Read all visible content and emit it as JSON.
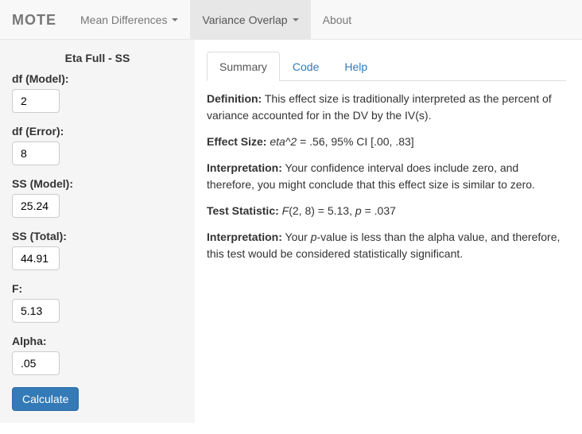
{
  "navbar": {
    "brand": "MOTE",
    "items": [
      {
        "label": "Mean Differences"
      },
      {
        "label": "Variance Overlap"
      },
      {
        "label": "About"
      }
    ]
  },
  "sidebar": {
    "title": "Eta Full - SS",
    "fields": {
      "df_model": {
        "label": "df (Model):",
        "value": "2"
      },
      "df_error": {
        "label": "df (Error):",
        "value": "8"
      },
      "ss_model": {
        "label": "SS (Model):",
        "value": "25.24"
      },
      "ss_total": {
        "label": "SS (Total):",
        "value": "44.91"
      },
      "f": {
        "label": "F:",
        "value": "5.13"
      },
      "alpha": {
        "label": "Alpha:",
        "value": ".05"
      }
    },
    "button": "Calculate"
  },
  "tabs": [
    {
      "label": "Summary"
    },
    {
      "label": "Code"
    },
    {
      "label": "Help"
    }
  ],
  "summary": {
    "definition_label": "Definition:",
    "definition_text": " This effect size is traditionally interpreted as the percent of variance accounted for in the DV by the IV(s).",
    "effect_size_label": "Effect Size:",
    "effect_size_stat": "eta^2",
    "effect_size_text": " = .56, 95% CI [.00, .83]",
    "interp1_label": "Interpretation:",
    "interp1_text": " Your confidence interval does include zero, and therefore, you might conclude that this effect size is similar to zero.",
    "test_stat_label": "Test Statistic:",
    "test_stat_f": "F",
    "test_stat_mid": "(2, 8) = 5.13, ",
    "test_stat_p": "p",
    "test_stat_end": " = .037",
    "interp2_label": "Interpretation:",
    "interp2_pre": " Your ",
    "interp2_p": "p",
    "interp2_post": "-value is less than the alpha value, and therefore, this test would be considered statistically significant."
  }
}
